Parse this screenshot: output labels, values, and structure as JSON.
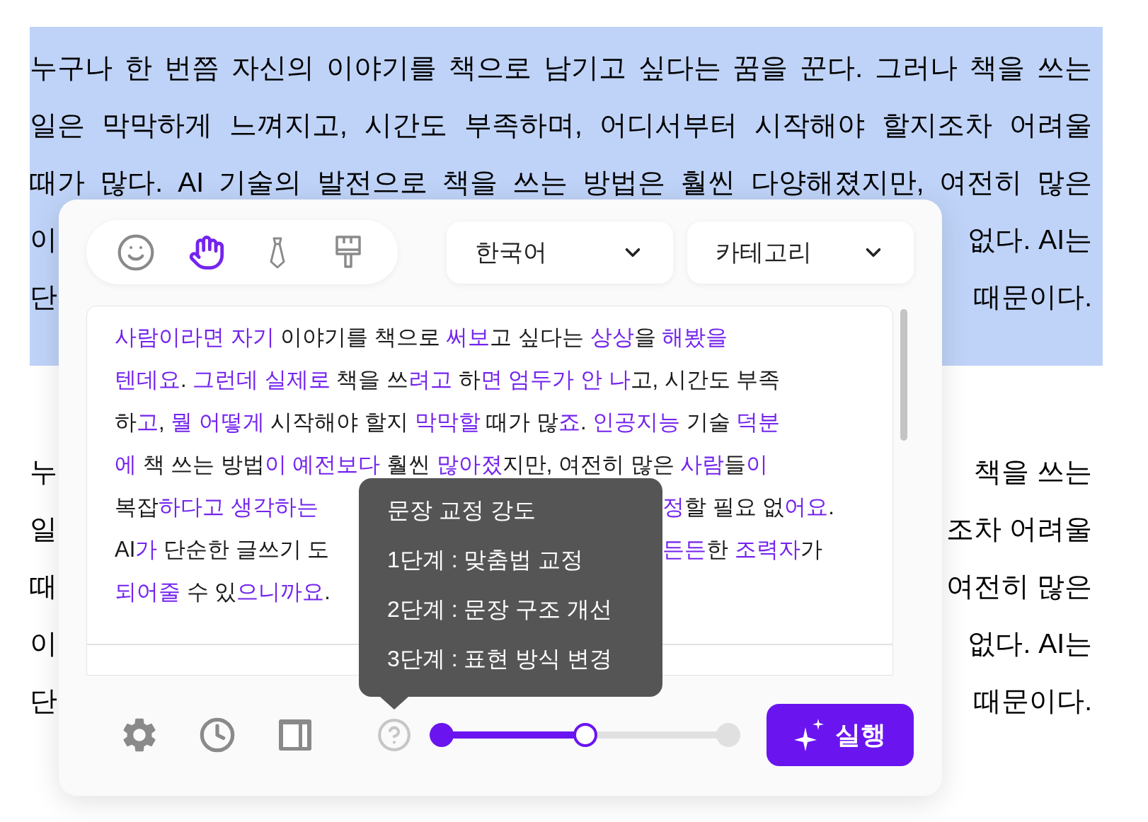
{
  "document": {
    "paragraphs": [
      {
        "selected": true,
        "lines": [
          {
            "kind": "full",
            "text": "누구나 한 번쯤 자신의 이야기를 책으로 남기고 싶다는 꿈을 꾼다. 그러나 책을 쓰는"
          },
          {
            "kind": "full",
            "text": "일은 막막하게 느껴지고, 시간도 부족하며, 어디서부터 시작해야 할지조차 어려울"
          },
          {
            "kind": "full",
            "text": "때가 많다. AI 기술의 발전으로 책을 쓰는 방법은 훨씬 다양해졌지만, 여전히 많은"
          },
          {
            "kind": "covered",
            "left": "이",
            "right": "없다. AI는"
          },
          {
            "kind": "covered",
            "left": "단",
            "right": "때문이다."
          }
        ]
      },
      {
        "selected": false,
        "lines": [
          {
            "kind": "covered",
            "left": "누",
            "right": "책을 쓰는"
          },
          {
            "kind": "covered",
            "left": "일",
            "right": "조차 어려울"
          },
          {
            "kind": "covered",
            "left": "때",
            "right": "여전히 많은"
          },
          {
            "kind": "covered",
            "left": "이",
            "right": "없다. AI는"
          },
          {
            "kind": "covered",
            "left": "단",
            "right": "때문이다."
          }
        ]
      }
    ]
  },
  "panel": {
    "style_modes": [
      {
        "selected": false
      },
      {
        "selected": true
      },
      {
        "selected": false
      },
      {
        "selected": false
      }
    ],
    "dropdowns": [
      {
        "value": "한국어"
      },
      {
        "value": "카테고리"
      }
    ],
    "suggestion": {
      "lines": [
        {
          "kind": "full",
          "segments": [
            {
              "text": "사람이라면 자기",
              "changed": true
            },
            {
              "text": " 이야기를 책으로 ",
              "changed": false
            },
            {
              "text": "써보",
              "changed": true
            },
            {
              "text": "고 싶다는 ",
              "changed": false
            },
            {
              "text": "상상",
              "changed": true
            },
            {
              "text": "을 ",
              "changed": false
            },
            {
              "text": "해봤을",
              "changed": true
            }
          ]
        },
        {
          "kind": "full",
          "segments": [
            {
              "text": "텐데요",
              "changed": true
            },
            {
              "text": ". ",
              "changed": false
            },
            {
              "text": "그런데 실제로",
              "changed": true
            },
            {
              "text": " 책을 쓰",
              "changed": false
            },
            {
              "text": "려고",
              "changed": true
            },
            {
              "text": " 하",
              "changed": false
            },
            {
              "text": "면 엄두가 안 나",
              "changed": true
            },
            {
              "text": "고, 시간도 부족",
              "changed": false
            }
          ]
        },
        {
          "kind": "full",
          "segments": [
            {
              "text": "하",
              "changed": false
            },
            {
              "text": "고",
              "changed": true
            },
            {
              "text": ", ",
              "changed": false
            },
            {
              "text": "뭘 어떻게",
              "changed": true
            },
            {
              "text": " 시작해야 할지 ",
              "changed": false
            },
            {
              "text": "막막할",
              "changed": true
            },
            {
              "text": " 때가 많",
              "changed": false
            },
            {
              "text": "죠",
              "changed": true
            },
            {
              "text": ". ",
              "changed": false
            },
            {
              "text": "인공지능",
              "changed": true
            },
            {
              "text": " 기술 ",
              "changed": false
            },
            {
              "text": "덕분",
              "changed": true
            }
          ]
        },
        {
          "kind": "full",
          "segments": [
            {
              "text": "에",
              "changed": true
            },
            {
              "text": " 책 쓰는 방법",
              "changed": false
            },
            {
              "text": "이 예전보다",
              "changed": true
            },
            {
              "text": " 훨씬 ",
              "changed": false
            },
            {
              "text": "많아졌",
              "changed": true
            },
            {
              "text": "지만, 여전히 많은 ",
              "changed": false
            },
            {
              "text": "사람",
              "changed": true
            },
            {
              "text": "들",
              "changed": false
            },
            {
              "text": "이",
              "changed": true
            }
          ]
        },
        {
          "kind": "covered",
          "left": [
            {
              "text": "복잡",
              "changed": false
            },
            {
              "text": "하다고 생각하는",
              "changed": true
            }
          ],
          "right": [
            {
              "text": "정",
              "changed": true
            },
            {
              "text": "할 필요 없",
              "changed": false
            },
            {
              "text": "어요",
              "changed": true
            },
            {
              "text": ".",
              "changed": false
            }
          ]
        },
        {
          "kind": "covered",
          "left": [
            {
              "text": "AI",
              "changed": false
            },
            {
              "text": "가",
              "changed": true
            },
            {
              "text": " 단순한 글쓰기 도",
              "changed": false
            }
          ],
          "right": [
            {
              "text": "든든",
              "changed": true
            },
            {
              "text": "한 ",
              "changed": false
            },
            {
              "text": "조력자",
              "changed": true
            },
            {
              "text": "가",
              "changed": false
            }
          ]
        },
        {
          "kind": "full",
          "segments": [
            {
              "text": "되어줄",
              "changed": true
            },
            {
              "text": " 수 있",
              "changed": false
            },
            {
              "text": "으니까요",
              "changed": true
            },
            {
              "text": ".",
              "changed": false
            }
          ]
        }
      ]
    },
    "tooltip": {
      "title": "문장 교정 강도",
      "items": [
        "1단계 : 맞춤법 교정",
        "2단계 : 문장 구조 개선",
        "3단계 : 표현 방식 변경"
      ]
    },
    "strength": {
      "level": 0.5
    },
    "run_button": {
      "label": "실행"
    }
  }
}
